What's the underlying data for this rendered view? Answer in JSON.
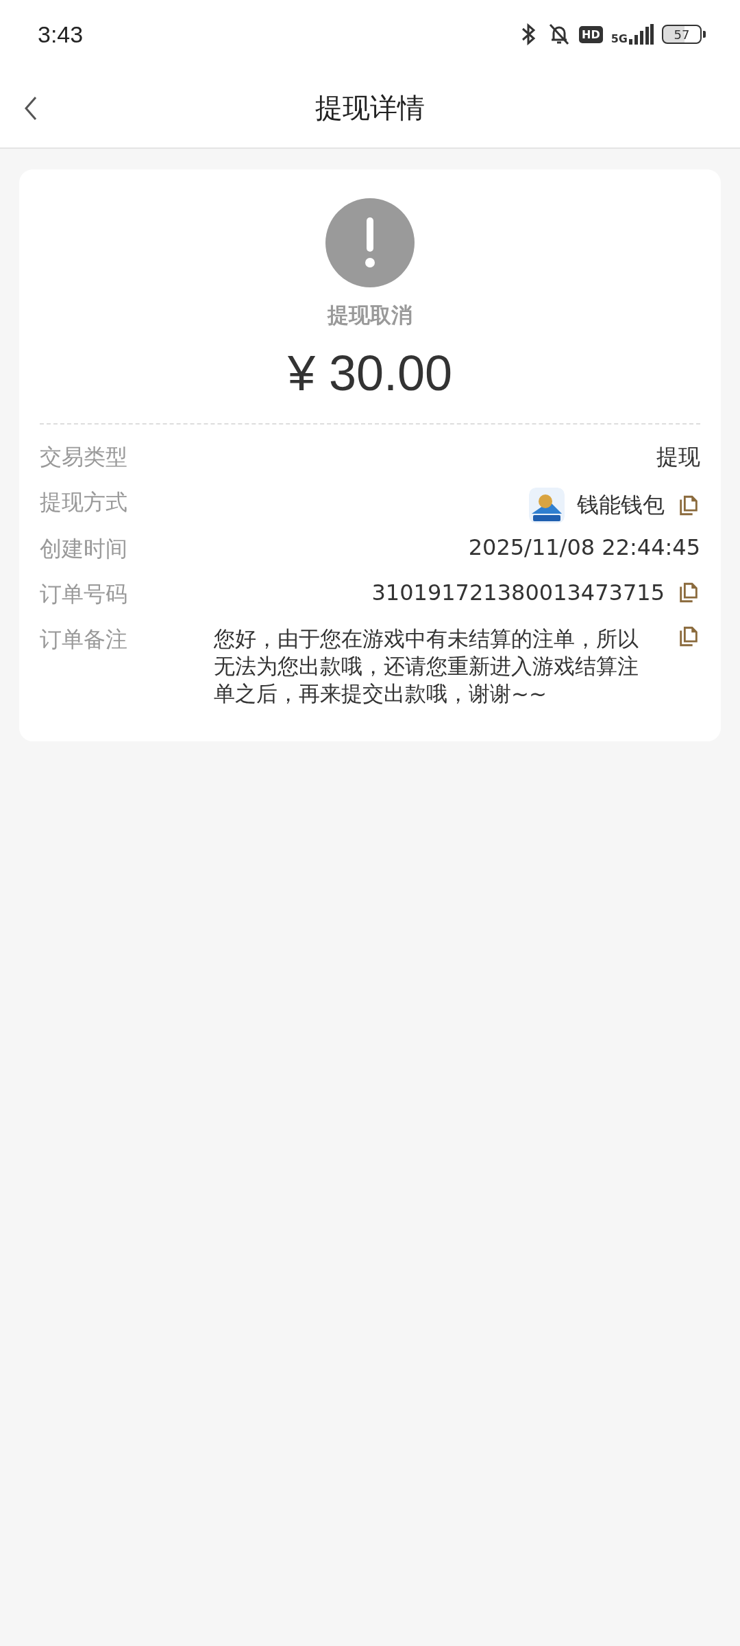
{
  "status_bar": {
    "time": "3:43",
    "hd": "HD",
    "network": "5G",
    "battery": "57"
  },
  "header": {
    "title": "提现详情"
  },
  "summary": {
    "status": "提现取消",
    "amount": "¥ 30.00"
  },
  "rows": [
    {
      "kind": "text",
      "label": "交易类型",
      "value": "提现"
    },
    {
      "kind": "app",
      "label": "提现方式",
      "value": "钱能钱包"
    },
    {
      "kind": "text",
      "label": "创建时间",
      "value": "2025/11/08 22:44:45"
    },
    {
      "kind": "copy",
      "label": "订单号码",
      "value": "310191721380013473715"
    },
    {
      "kind": "note",
      "label": "订单备注",
      "value": "您好，由于您在游戏中有未结算的注单，所以无法为您出款哦，还请您重新进入游戏结算注单之后，再来提交出款哦，谢谢~~"
    }
  ]
}
